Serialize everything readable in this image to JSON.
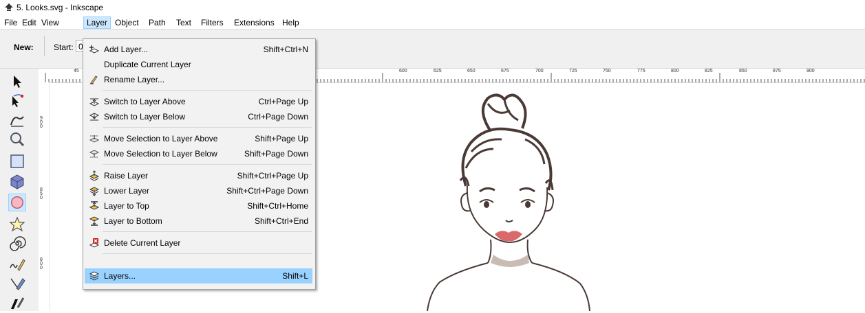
{
  "window": {
    "title": "5. Looks.svg - Inkscape"
  },
  "menubar": [
    {
      "label": "File"
    },
    {
      "label": "Edit"
    },
    {
      "label": "View"
    },
    {
      "label": "Layer"
    },
    {
      "label": "Object"
    },
    {
      "label": "Path"
    },
    {
      "label": "Text"
    },
    {
      "label": "Filters"
    },
    {
      "label": "Extensions"
    },
    {
      "label": "Help"
    }
  ],
  "toolbar": {
    "new_label": "New:",
    "start_label": "Start:",
    "start_value": "0"
  },
  "ruler": {
    "top_ticks": [
      "45",
      "600",
      "625",
      "650",
      "675",
      "700",
      "725",
      "750",
      "775",
      "800",
      "825",
      "850",
      "875",
      "900"
    ],
    "left_ticks": [
      "900",
      "850",
      "800"
    ]
  },
  "layer_menu": {
    "items": [
      {
        "label": "Add Layer...",
        "shortcut": "Shift+Ctrl+N",
        "icon": "add-layer-icon"
      },
      {
        "label": "Duplicate Current Layer",
        "shortcut": "",
        "icon": ""
      },
      {
        "label": "Rename Layer...",
        "shortcut": "",
        "icon": "rename-layer-icon"
      },
      {
        "label": "Switch to Layer Above",
        "shortcut": "Ctrl+Page Up",
        "icon": "switch-layer-above-icon"
      },
      {
        "label": "Switch to Layer Below",
        "shortcut": "Ctrl+Page Down",
        "icon": "switch-layer-below-icon"
      },
      {
        "label": "Move Selection to Layer Above",
        "shortcut": "Shift+Page Up",
        "icon": "move-selection-above-icon"
      },
      {
        "label": "Move Selection to Layer Below",
        "shortcut": "Shift+Page Down",
        "icon": "move-selection-below-icon"
      },
      {
        "label": "Raise Layer",
        "shortcut": "Shift+Ctrl+Page Up",
        "icon": "raise-layer-icon"
      },
      {
        "label": "Lower Layer",
        "shortcut": "Shift+Ctrl+Page Down",
        "icon": "lower-layer-icon"
      },
      {
        "label": "Layer to Top",
        "shortcut": "Shift+Ctrl+Home",
        "icon": "layer-to-top-icon"
      },
      {
        "label": "Layer to Bottom",
        "shortcut": "Shift+Ctrl+End",
        "icon": "layer-to-bottom-icon"
      },
      {
        "label": "Delete Current Layer",
        "shortcut": "",
        "icon": "delete-layer-icon"
      },
      {
        "label": "Layers...",
        "shortcut": "Shift+L",
        "icon": "layers-dialog-icon"
      }
    ]
  },
  "colors": {
    "menu_highlight": "#99d1ff",
    "menubar_active": "#cce8ff",
    "line_art": "#4a3a36",
    "lips": "#d9696b",
    "neck_shadow": "#c9bcb5"
  }
}
